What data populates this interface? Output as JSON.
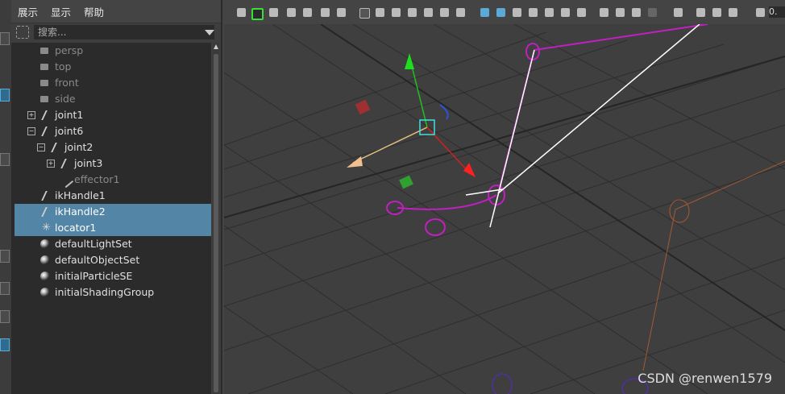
{
  "outliner": {
    "menu": [
      "展示",
      "显示",
      "帮助"
    ],
    "search": {
      "placeholder": "搜索..."
    },
    "items": [
      {
        "label": "persp",
        "icon": "camera-icon"
      },
      {
        "label": "top",
        "icon": "camera-icon"
      },
      {
        "label": "front",
        "icon": "camera-icon"
      },
      {
        "label": "side",
        "icon": "camera-icon"
      },
      {
        "label": "joint1",
        "icon": "joint-icon"
      },
      {
        "label": "joint6",
        "icon": "joint-icon"
      },
      {
        "label": "joint2",
        "icon": "joint-icon"
      },
      {
        "label": "joint3",
        "icon": "joint-icon"
      },
      {
        "label": "effector1",
        "icon": "effector-icon"
      },
      {
        "label": "ikHandle1",
        "icon": "ik-handle-icon"
      },
      {
        "label": "ikHandle2",
        "icon": "ik-handle-icon"
      },
      {
        "label": "locator1",
        "icon": "locator-icon"
      },
      {
        "label": "defaultLightSet",
        "icon": "set-icon"
      },
      {
        "label": "defaultObjectSet",
        "icon": "set-icon"
      },
      {
        "label": "initialParticleSE",
        "icon": "shading-group-icon"
      },
      {
        "label": "initialShadingGroup",
        "icon": "shading-group-icon"
      }
    ]
  },
  "viewport": {
    "toolbar_value": "0.",
    "watermark": "CSDN @renwen1579"
  },
  "colors": {
    "selection": "#5285a6",
    "ik_chain": "#c020c0",
    "background": "#3f3f3f"
  }
}
